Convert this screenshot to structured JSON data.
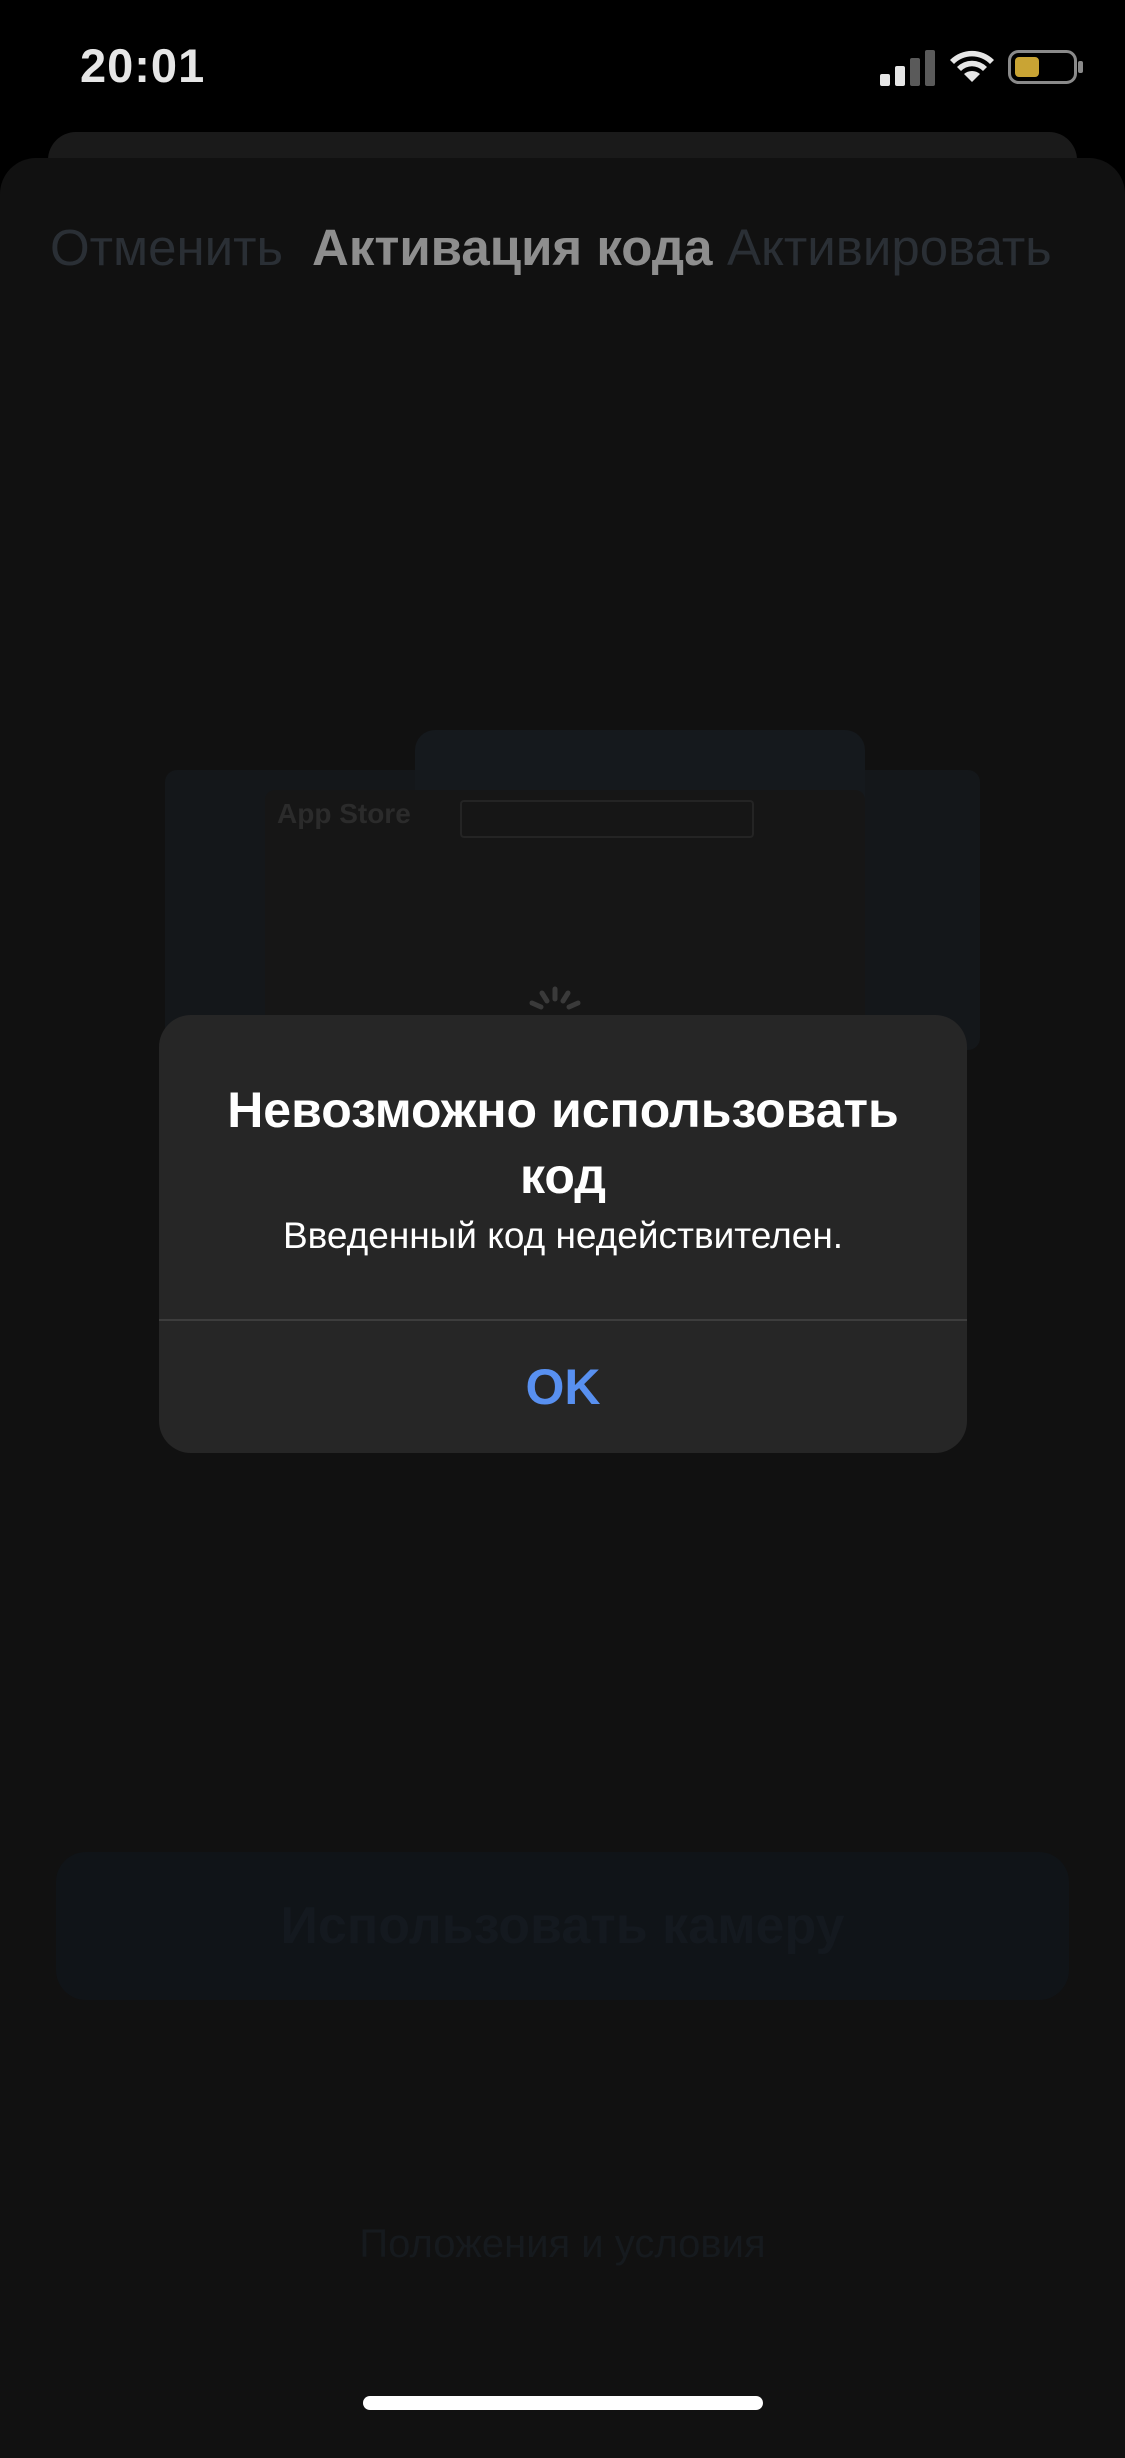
{
  "status_bar": {
    "time": "20:01",
    "signal_icon": "cellular-signal-icon",
    "wifi_icon": "wifi-icon",
    "battery_icon": "battery-low-icon",
    "battery_color": "#c9a434"
  },
  "nav": {
    "cancel_label": "Отменить",
    "title": "Активация кода",
    "activate_label": "Активировать"
  },
  "background": {
    "illustration_label": "App Store",
    "camera_button_label": "Использовать камеру",
    "terms_label": "Положения и условия"
  },
  "alert": {
    "title": "Невозможно использовать код",
    "message": "Введенный код недействителен.",
    "ok_label": "OK",
    "ok_color": "#5890f0"
  }
}
